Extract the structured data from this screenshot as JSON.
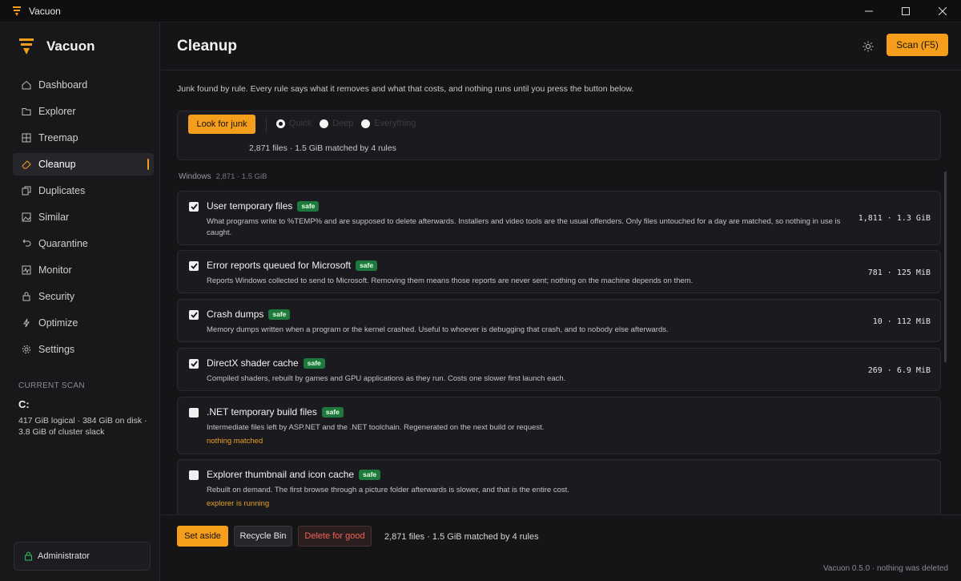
{
  "window": {
    "title": "Vacuon",
    "controls": [
      "minimize-icon",
      "maximize-icon",
      "close-icon"
    ]
  },
  "brand": {
    "name": "Vacuon",
    "accent": "#f59e1b"
  },
  "sidebar": {
    "items": [
      {
        "label": "Dashboard",
        "icon": "home-icon"
      },
      {
        "label": "Explorer",
        "icon": "folder-icon"
      },
      {
        "label": "Treemap",
        "icon": "grid-icon"
      },
      {
        "label": "Cleanup",
        "icon": "eraser-icon",
        "active": true
      },
      {
        "label": "Duplicates",
        "icon": "copy-icon"
      },
      {
        "label": "Similar",
        "icon": "image-icon"
      },
      {
        "label": "Quarantine",
        "icon": "undo-icon"
      },
      {
        "label": "Monitor",
        "icon": "pulse-icon"
      },
      {
        "label": "Security",
        "icon": "lock-icon"
      },
      {
        "label": "Optimize",
        "icon": "bolt-icon"
      },
      {
        "label": "Settings",
        "icon": "gear-icon"
      }
    ],
    "current_scan": {
      "caption": "CURRENT SCAN",
      "drive": "C:",
      "description": "417 GiB logical · 384 GiB on disk · 3.8 GiB of cluster slack"
    },
    "user": {
      "label": "Administrator",
      "icon": "lock-icon"
    }
  },
  "header": {
    "title": "Cleanup",
    "theme_icon": "sun-icon",
    "scan_button": "Scan  (F5)"
  },
  "intro": "Junk found by rule. Every rule says what it removes and what that costs, and nothing runs until you press the button below.",
  "search_card": {
    "look_button": "Look for junk",
    "modes": [
      {
        "label": "Quick",
        "selected": true
      },
      {
        "label": "Deep",
        "selected": false
      },
      {
        "label": "Everything",
        "selected": false
      }
    ],
    "summary": "2,871 files · 1.5 GiB matched by 4 rules"
  },
  "section": {
    "name": "Windows",
    "count": "2,871 · 1.5 GiB"
  },
  "rules": [
    {
      "title": "User temporary files",
      "badge": "safe",
      "checked": true,
      "description": "What programs write to %TEMP% and are supposed to delete afterwards. Installers and video tools are the usual offenders. Only files untouched for a day are matched, so nothing in use is caught.",
      "stat": "1,811 · 1.3 GiB",
      "note": ""
    },
    {
      "title": "Error reports queued for Microsoft",
      "badge": "safe",
      "checked": true,
      "description": "Reports Windows collected to send to Microsoft. Removing them means those reports are never sent; nothing on the machine depends on them.",
      "stat": "781 · 125 MiB",
      "note": ""
    },
    {
      "title": "Crash dumps",
      "badge": "safe",
      "checked": true,
      "description": "Memory dumps written when a program or the kernel crashed. Useful to whoever is debugging that crash, and to nobody else afterwards.",
      "stat": "10 · 112 MiB",
      "note": ""
    },
    {
      "title": "DirectX shader cache",
      "badge": "safe",
      "checked": true,
      "description": "Compiled shaders, rebuilt by games and GPU applications as they run. Costs one slower first launch each.",
      "stat": "269 · 6.9 MiB",
      "note": ""
    },
    {
      "title": ".NET temporary build files",
      "badge": "safe",
      "checked": false,
      "description": "Intermediate files left by ASP.NET and the .NET toolchain. Regenerated on the next build or request.",
      "stat": "",
      "note": "nothing matched"
    },
    {
      "title": "Explorer thumbnail and icon cache",
      "badge": "safe",
      "checked": false,
      "description": "Rebuilt on demand. The first browse through a picture folder afterwards is slower, and that is the entire cost.",
      "stat": "",
      "note": "explorer is running"
    }
  ],
  "footer": {
    "set_aside": "Set aside",
    "recycle_bin": "Recycle Bin",
    "delete_for_good": "Delete for good",
    "summary": "2,871 files · 1.5 GiB matched by 4 rules"
  },
  "status": "Vacuon 0.5.0 · nothing was deleted"
}
